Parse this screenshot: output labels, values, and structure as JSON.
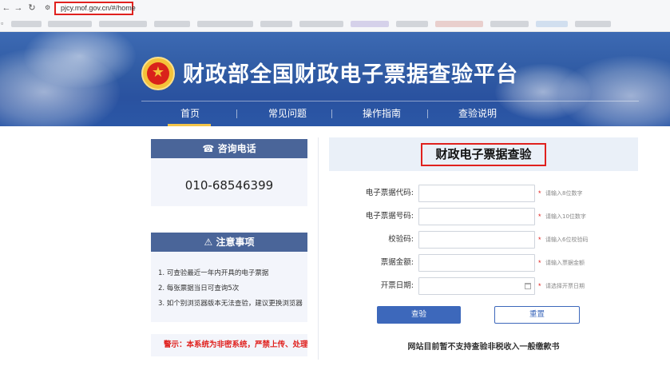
{
  "browser": {
    "back_icon": "back-arrow-icon",
    "forward_icon": "forward-arrow-icon",
    "reload_icon": "reload-icon",
    "url": "pjcy.mof.gov.cn/#/home"
  },
  "header": {
    "site_title": "财政部全国财政电子票据查验平台",
    "nav": [
      "首页",
      "常见问题",
      "操作指南",
      "查验说明"
    ],
    "active_nav": "首页",
    "accent_color": "#f3c54a",
    "banner_color": "#2f5aa3"
  },
  "sidebar": {
    "contact": {
      "heading": "咨询电话",
      "icon": "phone-icon",
      "phone": "010-68546399"
    },
    "notice": {
      "heading": "注意事项",
      "icon": "warning-icon",
      "items": [
        "1. 可查验最近一年内开具的电子票据",
        "2. 每张票据当日可查询5次",
        "3. 如个别浏览器版本无法查验，建议更换浏览器"
      ]
    },
    "warning": "警示：本系统为非密系统，严禁上传、处理涉密信息"
  },
  "form": {
    "title": "财政电子票据查验",
    "fields": [
      {
        "label": "电子票据代码:",
        "value": "",
        "hint": "请输入8位数字"
      },
      {
        "label": "电子票据号码:",
        "value": "",
        "hint": "请输入10位数字"
      },
      {
        "label": "校验码:",
        "value": "",
        "hint": "请输入6位校验码"
      },
      {
        "label": "票据金额:",
        "value": "",
        "hint": "请输入票据金额"
      },
      {
        "label": "开票日期:",
        "value": "",
        "hint": "请选择开票日期"
      }
    ],
    "query_button": "查验",
    "reset_button": "重置",
    "bottom_note": "网站目前暂不支持查验非税收入一般缴款书"
  }
}
